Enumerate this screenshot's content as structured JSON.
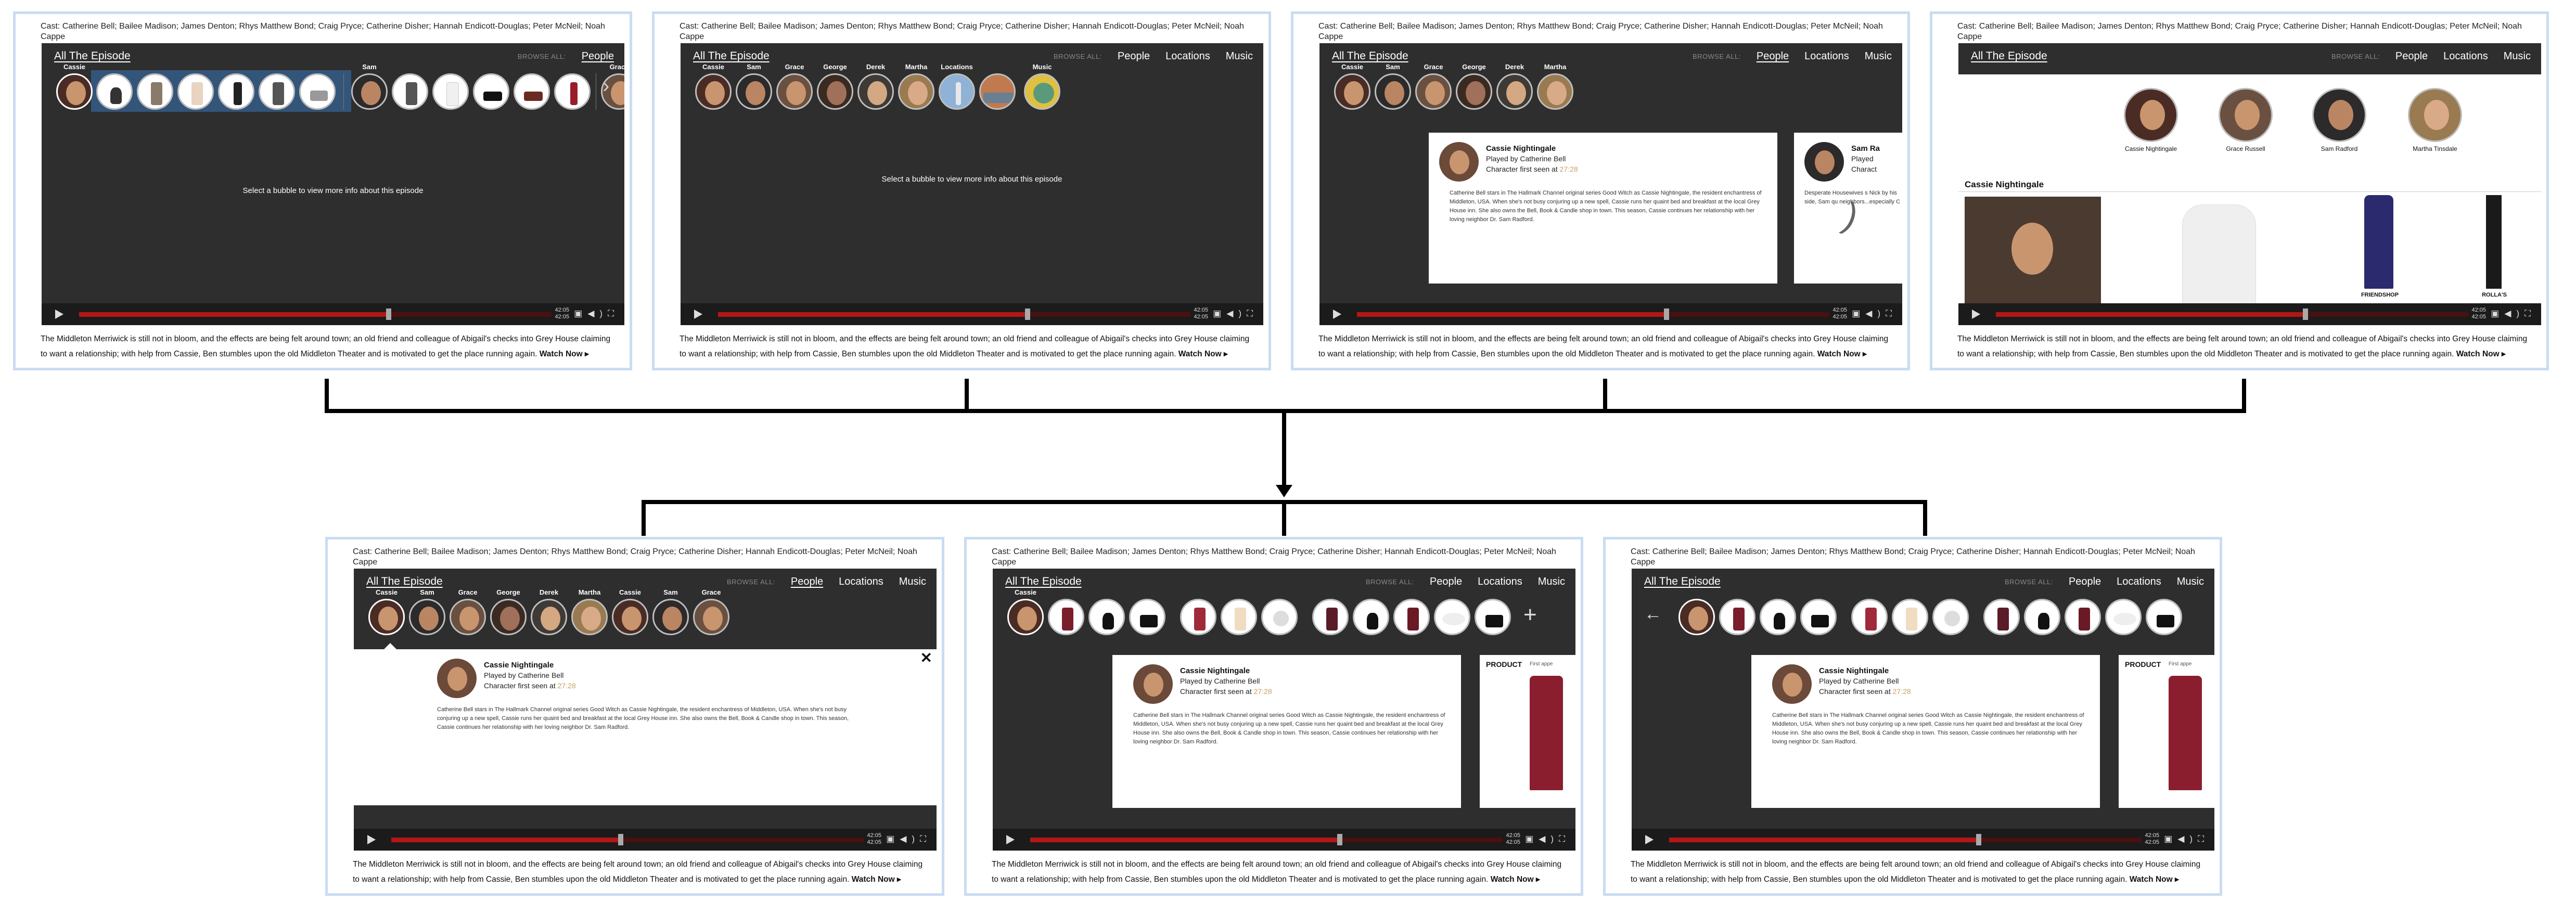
{
  "cast_text": "Cast: Catherine Bell; Bailee Madison; James Denton; Rhys Matthew Bond; Craig Pryce; Catherine Disher; Hannah Endicott-Douglas; Peter McNeil; Noah Cappe",
  "episode_description": "The Middleton Merriwick is still not in bloom, and the effects are being felt around town; an old friend and colleague of Abigail's checks into Grey House claiming to want a relationship; with help from Cassie, Ben stumbles upon the old Middleton Theater and is motivated to get the place running again.",
  "watch_now": "Watch Now ▸",
  "all_episode": "All The Episode",
  "browse_all": "BROWSE ALL:",
  "nav": {
    "people": "People",
    "locations": "Locations",
    "music": "Music"
  },
  "prompt": "Select a bubble to view more info about this episode",
  "player": {
    "time_current": "42:05",
    "time_total": "42:05",
    "progress_percent": 48
  },
  "bubble_labels": {
    "cassie": "Cassie",
    "sam": "Sam",
    "grace": "Grace",
    "george": "George",
    "derek": "Derek",
    "martha": "Martha",
    "locations": "Locations",
    "music": "Music"
  },
  "character_card": {
    "name": "Cassie Nightingale",
    "played_by": "Played by Catherine Bell",
    "first_seen_prefix": "Character first seen at",
    "first_seen_time": "27:28",
    "bio": "Catherine Bell stars in The Hallmark Channel original series Good Witch as Cassie Nightingale, the resident enchantress of Middleton, USA. When she's not busy conjuring up a new spell, Cassie runs her quaint bed and breakfast at the local Grey House inn. She also owns the Bell, Book & Candle shop in town. This season, Cassie continues her relationship with her loving neighbor Dr. Sam Radford."
  },
  "sam_card": {
    "name": "Sam Ra",
    "played": "Played",
    "charac": "Charact",
    "bio": "Desperate Housewives s Nick by his side, Sam qu neighbors...especially C"
  },
  "grid_people": [
    "Cassie Nightingale",
    "Grace Russell",
    "Sam Radford",
    "Martha Tinsdale"
  ],
  "grid_section_title": "Cassie Nightingale",
  "grid_products": [
    "FRIENDSHOP",
    "ROLLA'S"
  ],
  "product_card": {
    "label": "PRODUCT",
    "first_seen": "First appe"
  },
  "close_symbol": "✕",
  "plus_symbol": "+",
  "back_symbol": "←",
  "colors": {
    "progress": "#b51616",
    "panel_border": "#c9dcf2",
    "player_bg": "#2e2e2e"
  }
}
